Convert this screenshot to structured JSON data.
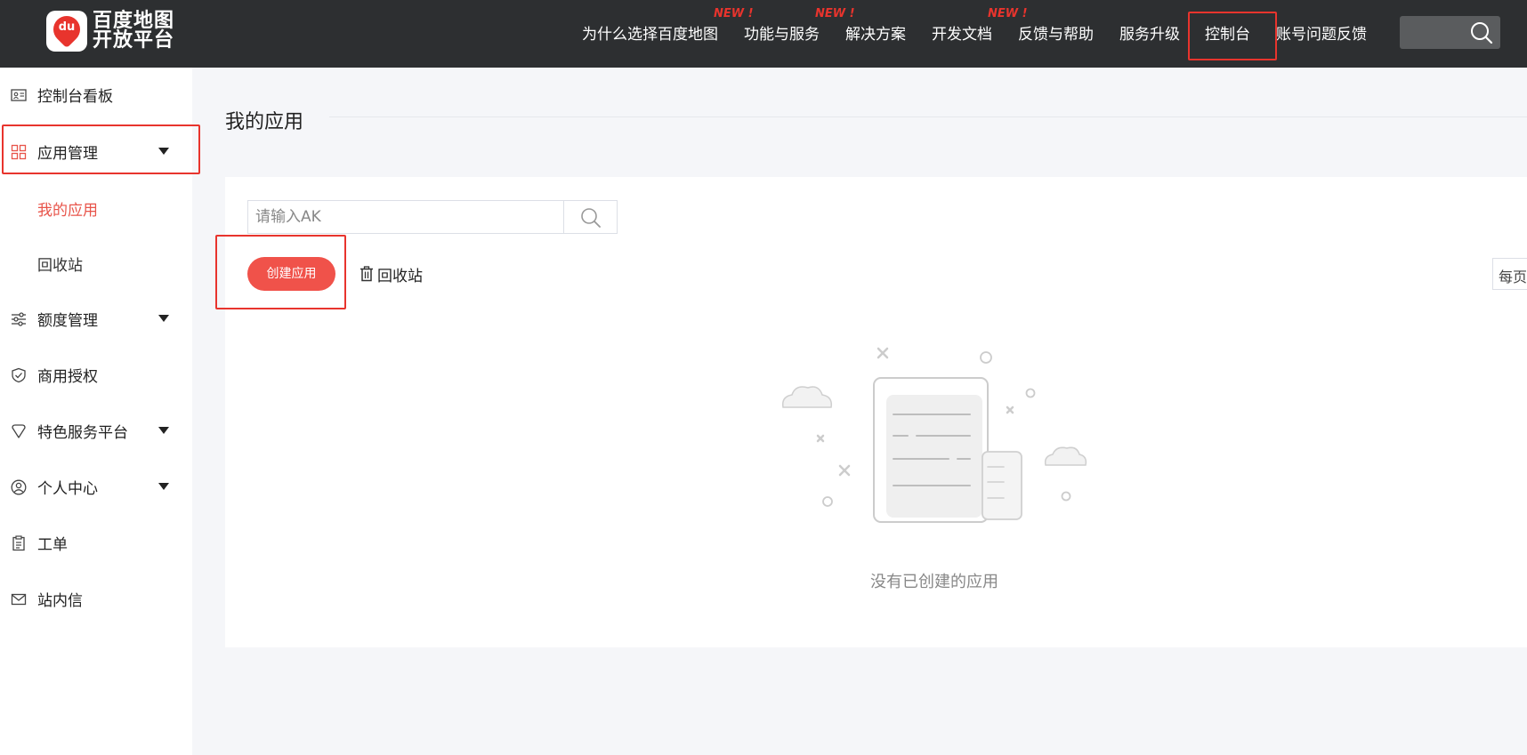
{
  "header": {
    "logo": {
      "line1": "百度地图",
      "line2": "开放平台",
      "mark": "du"
    },
    "nav": [
      {
        "label": "为什么选择百度地图",
        "badge": "NEW !"
      },
      {
        "label": "功能与服务",
        "badge": "NEW !"
      },
      {
        "label": "解决方案",
        "badge": ""
      },
      {
        "label": "开发文档",
        "badge": "NEW !"
      },
      {
        "label": "反馈与帮助",
        "badge": ""
      },
      {
        "label": "服务升级",
        "badge": ""
      },
      {
        "label": "控制台",
        "badge": ""
      },
      {
        "label": "账号问题反馈",
        "badge": ""
      }
    ],
    "search_icon": "search-icon"
  },
  "sidebar": {
    "items": [
      {
        "label": "控制台看板",
        "icon": "dashboard-card-icon"
      },
      {
        "label": "应用管理",
        "icon": "grid-icon"
      },
      {
        "label": "额度管理",
        "icon": "sliders-icon"
      },
      {
        "label": "商用授权",
        "icon": "shield-check-icon"
      },
      {
        "label": "特色服务平台",
        "icon": "diamond-icon"
      },
      {
        "label": "个人中心",
        "icon": "user-circle-icon"
      },
      {
        "label": "工单",
        "icon": "clipboard-icon"
      },
      {
        "label": "站内信",
        "icon": "mail-icon"
      }
    ],
    "sub_items": [
      {
        "label": "我的应用",
        "active": true
      },
      {
        "label": "回收站",
        "active": false
      }
    ]
  },
  "main": {
    "page_title": "我的应用",
    "search_placeholder": "请输入AK",
    "create_button": "创建应用",
    "recycle_label": "回收站",
    "per_page_label": "每页",
    "empty_text": "没有已创建的应用"
  },
  "colors": {
    "accent": "#f0524a",
    "highlight_box": "#e8342d",
    "topbar_bg": "#2d2f31",
    "page_bg": "#f5f6f9"
  }
}
